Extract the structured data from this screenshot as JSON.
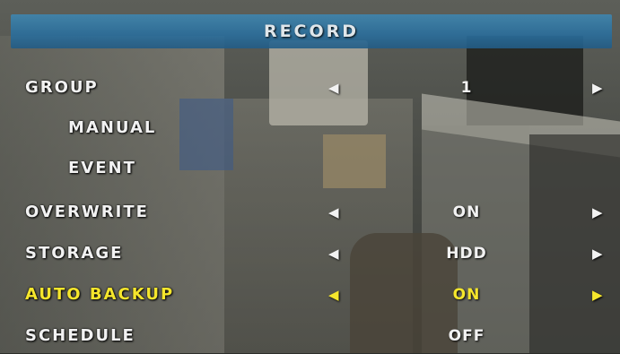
{
  "menu": {
    "title": "RECORD",
    "left_arrow": "◀",
    "right_arrow": "▶",
    "highlight_color": "#f5e62c",
    "items": [
      {
        "label": "GROUP",
        "value": "1"
      },
      {
        "label": "MANUAL"
      },
      {
        "label": "EVENT"
      },
      {
        "label": "OVERWRITE",
        "value": "ON"
      },
      {
        "label": "STORAGE",
        "value": "HDD"
      },
      {
        "label": "AUTO BACKUP",
        "value": "ON",
        "selected": true
      },
      {
        "label": "SCHEDULE",
        "value": "OFF"
      }
    ]
  }
}
